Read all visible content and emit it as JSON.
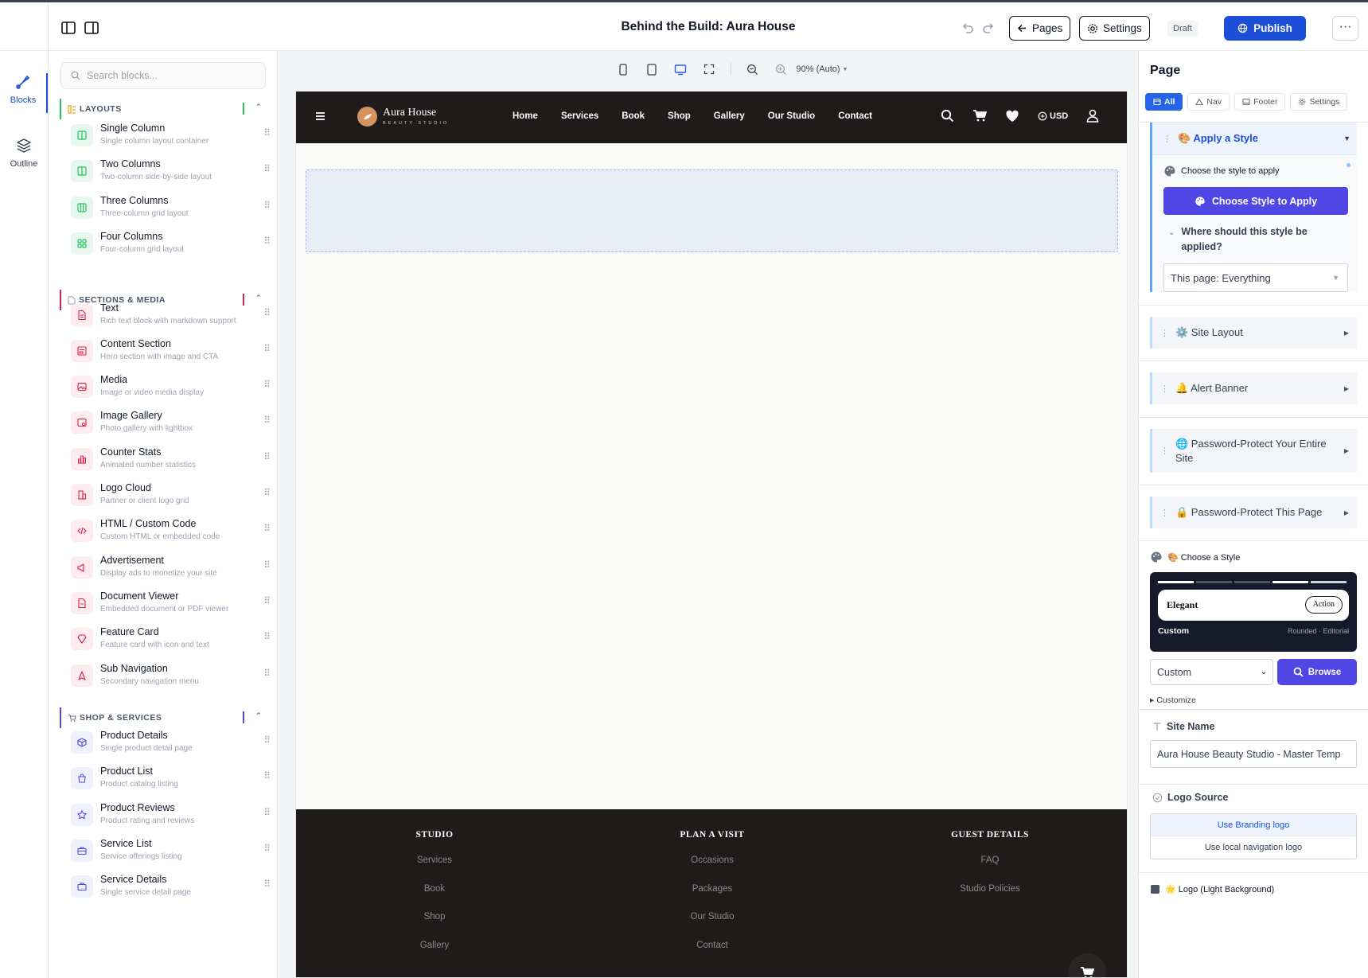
{
  "topbar": {
    "title": "Behind the Build: Aura House",
    "pages_label": "Pages",
    "settings_label": "Settings",
    "status": "Draft",
    "publish_label": "Publish",
    "more_label": "···"
  },
  "rail": {
    "blocks_label": "Blocks",
    "outline_label": "Outline"
  },
  "library": {
    "search_placeholder": "Search blocks...",
    "sections": [
      {
        "title": "LAYOUTS",
        "color": "#22c55e"
      },
      {
        "title": "SECTIONS & MEDIA",
        "color": "#e11d48"
      },
      {
        "title": "SHOP & SERVICES",
        "color": "#4f46e5"
      }
    ],
    "layouts": [
      {
        "name": "Single Column",
        "desc": "Single column layout container"
      },
      {
        "name": "Two Columns",
        "desc": "Two-column side-by-side layout"
      },
      {
        "name": "Three Columns",
        "desc": "Three-column grid layout"
      },
      {
        "name": "Four Columns",
        "desc": "Four-column grid layout"
      }
    ],
    "media": [
      {
        "name": "Text",
        "desc": "Rich text block with markdown support"
      },
      {
        "name": "Content Section",
        "desc": "Hero section with image and CTA"
      },
      {
        "name": "Media",
        "desc": "Image or video media display"
      },
      {
        "name": "Image Gallery",
        "desc": "Photo gallery with lightbox"
      },
      {
        "name": "Counter Stats",
        "desc": "Animated number statistics"
      },
      {
        "name": "Logo Cloud",
        "desc": "Partner or client logo grid"
      },
      {
        "name": "HTML / Custom Code",
        "desc": "Custom HTML or embedded code"
      },
      {
        "name": "Advertisement",
        "desc": "Display ads to monetize your site"
      },
      {
        "name": "Document Viewer",
        "desc": "Embedded document or PDF viewer"
      },
      {
        "name": "Feature Card",
        "desc": "Feature card with icon and text"
      },
      {
        "name": "Sub Navigation",
        "desc": "Secondary navigation menu"
      }
    ],
    "shop": [
      {
        "name": "Product Details",
        "desc": "Single product detail page"
      },
      {
        "name": "Product List",
        "desc": "Product catalog listing"
      },
      {
        "name": "Product Reviews",
        "desc": "Product rating and reviews"
      },
      {
        "name": "Service List",
        "desc": "Service offerings listing"
      },
      {
        "name": "Service Details",
        "desc": "Single service detail page"
      }
    ]
  },
  "canvas": {
    "zoom": "90% (Auto)",
    "site": {
      "brand": "Aura House",
      "brand_sub": "BEAUTY STUDIO",
      "nav": [
        "Home",
        "Services",
        "Book",
        "Shop",
        "Gallery",
        "Our Studio",
        "Contact"
      ],
      "currency": "USD",
      "footer": [
        {
          "title": "STUDIO",
          "links": [
            "Services",
            "Book",
            "Shop",
            "Gallery"
          ]
        },
        {
          "title": "PLAN A VISIT",
          "links": [
            "Occasions",
            "Packages",
            "Our Studio",
            "Contact"
          ]
        },
        {
          "title": "GUEST DETAILS",
          "links": [
            "FAQ",
            "Studio Policies"
          ]
        }
      ]
    }
  },
  "panel": {
    "title": "Page",
    "filters": [
      "All",
      "Nav",
      "Footer",
      "Settings"
    ],
    "apply_style": {
      "header": "🎨 Apply a Style",
      "choose_label": "Choose the style to apply",
      "choose_button": "Choose Style to Apply",
      "where_question": "Where should this style be applied?",
      "scope_value": "This page: Everything"
    },
    "sections": [
      "⚙️ Site Layout",
      "🔔 Alert Banner",
      "🌐 Password-Protect Your Entire Site",
      "🔒 Password-Protect This Page"
    ],
    "style_card": {
      "label": "🎨 Choose a Style",
      "preview_name": "Elegant",
      "preview_action": "Action",
      "preview_title": "Custom",
      "preview_tags": "Rounded · Editorial",
      "select_value": "Custom",
      "browse_label": "Browse",
      "customize_label": "▸ Customize"
    },
    "site_name": {
      "label": "Site Name",
      "value": "Aura House Beauty Studio - Master Temp"
    },
    "logo_source": {
      "label": "Logo Source",
      "option_active": "Use Branding logo",
      "option_other": "Use local navigation logo"
    },
    "logo_light_label": "🌟 Logo (Light Background)"
  }
}
